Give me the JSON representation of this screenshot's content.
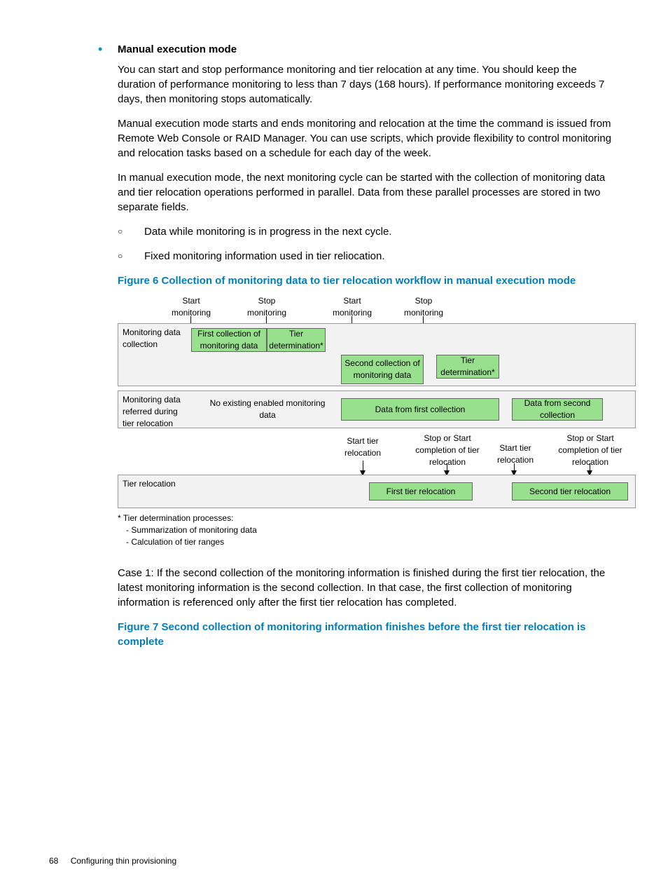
{
  "bullet_heading": "Manual execution mode",
  "paragraphs": {
    "p1": "You can start and stop performance monitoring and tier relocation at any time. You should keep the duration of performance monitoring to less than 7 days (168 hours). If performance monitoring exceeds 7 days, then monitoring stops automatically.",
    "p2": "Manual execution mode starts and ends monitoring and relocation at the time the command is issued from Remote Web Console or RAID Manager. You can use scripts, which provide flexibility to control monitoring and relocation tasks based on a schedule for each day of the week.",
    "p3": "In manual execution mode, the next monitoring cycle can be started with the collection of monitoring data and tier relocation operations performed in parallel. Data from these parallel processes are stored in two separate fields.",
    "case1": "Case 1: If the second collection of the monitoring information is finished during the first tier relocation, the latest monitoring information is the second collection. In that case, the first collection of monitoring information is referenced only after the first tier relocation has completed."
  },
  "sublist": {
    "s1": "Data while monitoring is in progress in the next cycle.",
    "s2": "Fixed monitoring information used in tier reliocation."
  },
  "figures": {
    "f6": "Figure 6 Collection of monitoring data to tier relocation workflow in manual execution mode",
    "f7": "Figure 7 Second collection of monitoring information finishes before the first tier relocation is complete"
  },
  "diagram": {
    "top_labels": {
      "l1": "Start\nmonitoring",
      "l2": "Stop\nmonitoring",
      "l3": "Start\nmonitoring",
      "l4": "Stop\nmonitoring"
    },
    "band1": {
      "label": "Monitoring data collection",
      "box1": "First collection of monitoring data",
      "box2": "Tier determination*",
      "box3": "Second collection of monitoring data",
      "box4": "Tier determination*"
    },
    "band2": {
      "label": "Monitoring data referred during tier relocation",
      "box1": "No existing enabled monitoring data",
      "box2": "Data from first collection",
      "box3": "Data from second collection"
    },
    "mid_labels": {
      "l1": "Start tier\nrelocation",
      "l2": "Stop or Start\ncompletion of tier\nrelocation",
      "l3": "Start tier\nrelocation",
      "l4": "Stop or Start\ncompletion of tier\nrelocation"
    },
    "band3": {
      "label": "Tier relocation",
      "box1": "First tier relocation",
      "box2": "Second tier relocation"
    }
  },
  "footnote": {
    "title": "* Tier determination processes:",
    "l1": "- Summarization of monitoring data",
    "l2": "- Calculation of tier ranges"
  },
  "footer": {
    "page": "68",
    "section": "Configuring thin provisioning"
  }
}
